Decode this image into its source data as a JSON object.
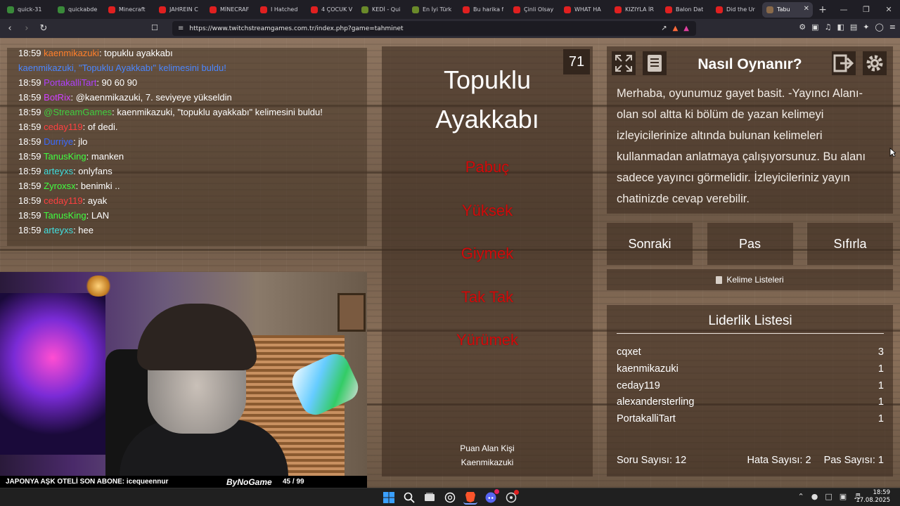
{
  "browser": {
    "tabs": [
      {
        "label": "quick-31",
        "color": "#3a8a3a"
      },
      {
        "label": "quickabde",
        "color": "#3a8a3a"
      },
      {
        "label": "Minecraft",
        "color": "#e02020"
      },
      {
        "label": "JAHREIN C",
        "color": "#e02020"
      },
      {
        "label": "MİNECRAF",
        "color": "#e02020"
      },
      {
        "label": "I Hatched",
        "color": "#e02020"
      },
      {
        "label": "4 ÇOCUK V",
        "color": "#e02020"
      },
      {
        "label": "KEDİ - Qui",
        "color": "#6a8a2a"
      },
      {
        "label": "En İyi Türk",
        "color": "#6a8a2a"
      },
      {
        "label": "Bu harika f",
        "color": "#e02020"
      },
      {
        "label": "Çinli Olsay",
        "color": "#e02020"
      },
      {
        "label": "WHAT HA",
        "color": "#e02020"
      },
      {
        "label": "KIZIYLA İR",
        "color": "#e02020"
      },
      {
        "label": "Balon Dat",
        "color": "#e02020"
      },
      {
        "label": "Did the Ur",
        "color": "#e02020"
      },
      {
        "label": "Tabu",
        "color": "#8a6a4a"
      }
    ],
    "url": "https://www.twitchstreamgames.com.tr/index.php?game=tahminet"
  },
  "chat": {
    "messages": [
      {
        "time": "18:59",
        "user": "kaenmikazuki",
        "color": "#ff7f2a",
        "text": ": topuklu ayakkabı"
      },
      {
        "time": "",
        "user": "kaenmikazuki, ",
        "color": "#4a86ff",
        "text": "\"Topuklu Ayakkabı\" kelimesini buldu!",
        "textColor": "#4a86ff",
        "highlight": "#3a9a3a"
      },
      {
        "time": "18:59",
        "user": "PortakalliTart",
        "color": "#b040ff",
        "text": ": 90 60 90"
      },
      {
        "time": "18:59",
        "user": "BotRix",
        "color": "#d040ff",
        "text": ": @kaenmikazuki, 7. seviyeye yükseldin"
      },
      {
        "time": "18:59",
        "user": "@StreamGames",
        "color": "#40d040",
        "text": ": kaenmikazuki, \"topuklu ayakkabı\" kelimesini buldu!"
      },
      {
        "time": "18:59",
        "user": "ceday119",
        "color": "#ff4040",
        "text": ": of dedi."
      },
      {
        "time": "18:59",
        "user": "Durriye",
        "color": "#3a6aff",
        "text": ": jlo"
      },
      {
        "time": "18:59",
        "user": "TanusKing",
        "color": "#40ff40",
        "text": ": manken"
      },
      {
        "time": "18:59",
        "user": "arteyxs",
        "color": "#40e0e0",
        "text": ": onlyfans"
      },
      {
        "time": "18:59",
        "user": "Zyroxsx",
        "color": "#40ff40",
        "text": ": benimki .."
      },
      {
        "time": "18:59",
        "user": "ceday119",
        "color": "#ff4040",
        "text": ": ayak"
      },
      {
        "time": "18:59",
        "user": "TanusKing",
        "color": "#40ff40",
        "text": ": LAN"
      },
      {
        "time": "18:59",
        "user": "arteyxs",
        "color": "#40e0e0",
        "text": ": hee"
      }
    ]
  },
  "stream_overlay": {
    "ticker": "JAPONYA AŞK OTELİ  SON ABONE: icequeennur",
    "brand": "ByNoGame",
    "progress_text": "45  /  99",
    "progress_fraction": 0.4545
  },
  "card": {
    "counter": "71",
    "word_line1": "Topuklu",
    "word_line2": "Ayakkabı",
    "taboo_words": [
      "Pabuç",
      "Yüksek",
      "Giymek",
      "Tak Tak",
      "Yürümek"
    ],
    "scorer_label": "Puan Alan Kişi",
    "scorer_name": "Kaenmikazuki"
  },
  "help": {
    "title": "Nasıl Oynanır?",
    "text": "Merhaba, oyunumuz gayet basit. -Yayıncı Alanı- olan sol altta ki bölüm de yazan kelimeyi izleyicilerinize altında bulunan kelimeleri kullanmadan anlatmaya çalışıyorsunuz. Bu alanı sadece yayıncı görmelidir. İzleyicileriniz yayın chatinizde cevap verebilir."
  },
  "buttons": {
    "next": "Sonraki",
    "pass": "Pas",
    "reset": "Sıfırla",
    "word_lists": "Kelime Listeleri"
  },
  "leaderboard": {
    "title": "Liderlik Listesi",
    "rows": [
      {
        "name": "cqxet",
        "score": "3"
      },
      {
        "name": "kaenmikazuki",
        "score": "1"
      },
      {
        "name": "ceday119",
        "score": "1"
      },
      {
        "name": "alexandersterling",
        "score": "1"
      },
      {
        "name": "PortakalliTart",
        "score": "1"
      }
    ],
    "question_count": "Soru Sayısı: 12",
    "error_count": "Hata Sayısı: 2",
    "pass_count": "Pas Sayısı: 1"
  },
  "taskbar": {
    "time": "18:59",
    "date": "17.08.2025"
  }
}
